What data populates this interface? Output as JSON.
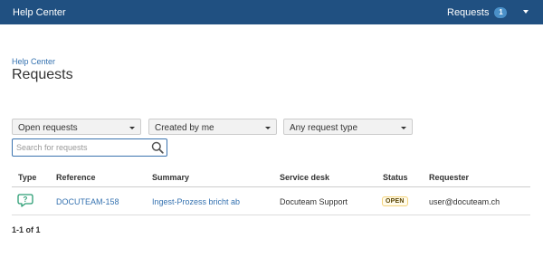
{
  "topbar": {
    "title": "Help Center",
    "requests_label": "Requests",
    "requests_count": "1",
    "bg_color": "#205081"
  },
  "breadcrumb": "Help Center",
  "page_title": "Requests",
  "filters": {
    "status": "Open requests",
    "creator": "Created by me",
    "request_type": "Any request type"
  },
  "search": {
    "placeholder": "Search for requests",
    "value": ""
  },
  "table": {
    "columns": [
      "Type",
      "Reference",
      "Summary",
      "Service desk",
      "Status",
      "Requester"
    ],
    "rows": [
      {
        "type_icon": "request-type-icon",
        "reference": "DOCUTEAM-158",
        "summary": "Ingest-Prozess bricht ab",
        "service_desk": "Docuteam Support",
        "status": "OPEN",
        "requester": "user@docuteam.ch"
      }
    ]
  },
  "pagination": "1-1 of 1"
}
